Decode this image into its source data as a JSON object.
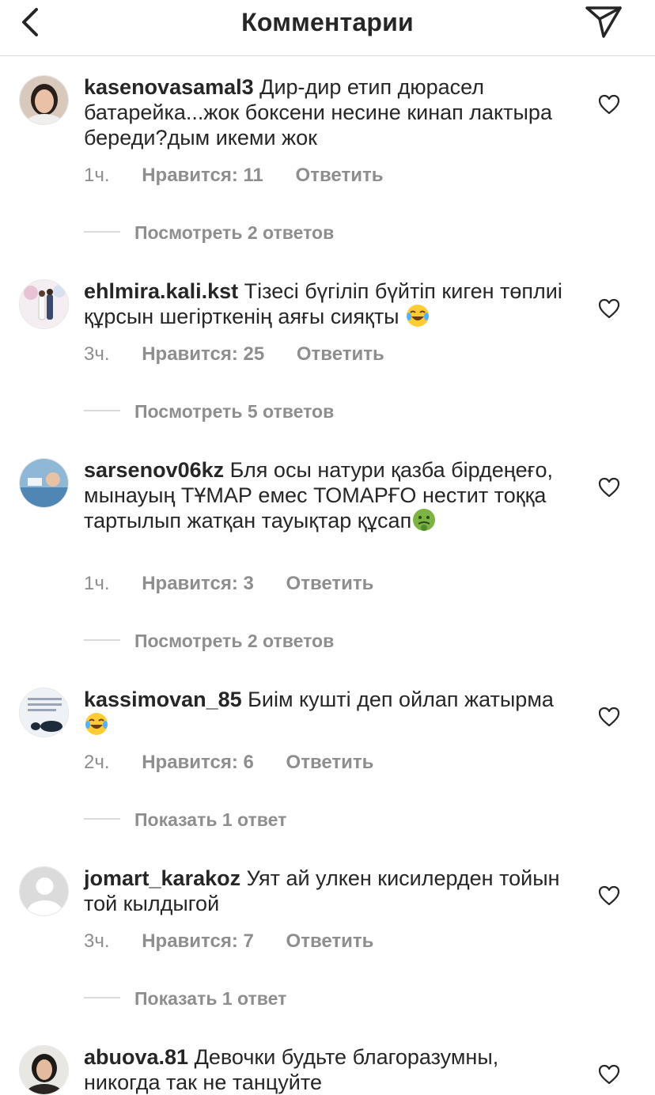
{
  "header": {
    "title": "Комментарии"
  },
  "comments": [
    {
      "username": "kasenovasamal3",
      "text": "Дир-дир етип дюрасел батарейка...жок боксени несине кинап лактыра береди?дым икеми жок",
      "time": "1ч.",
      "likes": "Нравится: 11",
      "reply": "Ответить",
      "replies": "Посмотреть 2 ответов"
    },
    {
      "username": "ehlmira.kali.kst",
      "text": "Тізесі бүгіліп бүйтіп киген төплиі құрсын шегірткенің аяғы сияқты",
      "emoji": "tears-of-joy",
      "time": "3ч.",
      "likes": "Нравится: 25",
      "reply": "Ответить",
      "replies": "Посмотреть 5 ответов"
    },
    {
      "username": "sarsenov06kz",
      "text": "Бля осы натури қазба бірдеңеғо, мынауың ТҰМАР емес ТОМАРҒО нестит тоққа тартылып жатқан тауықтар құсап",
      "emoji": "nauseated-face",
      "time": "1ч.",
      "likes": "Нравится: 3",
      "reply": "Ответить",
      "replies": "Посмотреть 2 ответов"
    },
    {
      "username": "kassimovan_85",
      "text": "Биім кушті деп ойлап жатырма",
      "emoji": "tears-of-joy",
      "time": "2ч.",
      "likes": "Нравится: 6",
      "reply": "Ответить",
      "replies": "Показать 1 ответ"
    },
    {
      "username": "jomart_karakoz",
      "text": "Уят ай улкен кисилерден тойын той кылдыгой",
      "time": "3ч.",
      "likes": "Нравится: 7",
      "reply": "Ответить",
      "replies": "Показать 1 ответ"
    },
    {
      "username": "abuova.81",
      "text": "Девочки будьте благоразумны, никогда так не танцуйте"
    }
  ],
  "icons": {
    "back": "chevron-left-icon",
    "send": "paper-plane-icon",
    "like": "heart-outline-icon"
  },
  "colors": {
    "text": "#262626",
    "secondary": "#8e8e8e",
    "divider": "#dbdbdb"
  }
}
